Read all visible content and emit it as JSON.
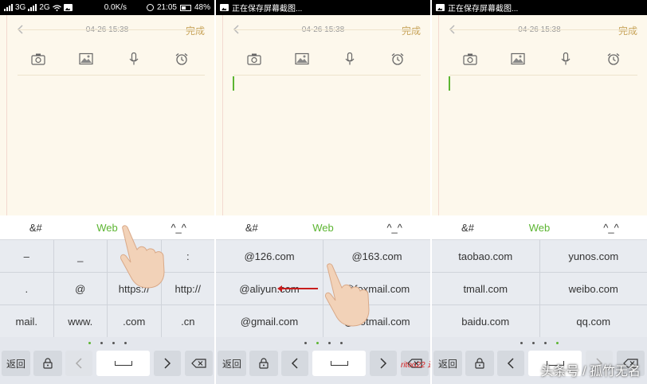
{
  "colors": {
    "accent_green": "#5cb531",
    "done_gold": "#c8a45a",
    "paper": "#fdf8ec",
    "keyboard": "#e4e7ed"
  },
  "panels": [
    {
      "status": {
        "network": "3G",
        "network2": "2G",
        "speed": "0.0K/s",
        "time": "21:05",
        "battery": "48%"
      },
      "header": {
        "date": "04-26 15:38",
        "done": "完成"
      },
      "tabs": [
        "&#",
        "Web",
        "^_^"
      ],
      "keys": [
        "–",
        "_",
        "/",
        ":",
        ".",
        "@",
        "https://",
        "http://",
        "mail.",
        "www.",
        ".com",
        ".cn"
      ],
      "page_dot_active": 0
    },
    {
      "status": {
        "notice": "正在保存屏幕截图..."
      },
      "header": {
        "date": "04-26 15:38",
        "done": "完成"
      },
      "tabs": [
        "&#",
        "Web",
        "^_^"
      ],
      "keys": [
        "@126.com",
        "@163.com",
        "@aliyun.com",
        "@foxmail.com",
        "@gmail.com",
        "@hotmail.com"
      ],
      "page_dot_active": 1
    },
    {
      "status": {
        "notice": "正在保存屏幕截图..."
      },
      "header": {
        "date": "04-26 15:38",
        "done": "完成"
      },
      "tabs": [
        "&#",
        "Web",
        "^_^"
      ],
      "keys": [
        "taobao.com",
        "yunos.com",
        "tmall.com",
        "weibo.com",
        "baidu.com",
        "qq.com"
      ],
      "page_dot_active": 3
    }
  ],
  "bottom_row": {
    "back": "返回"
  },
  "toolbar_icons": [
    "camera-icon",
    "image-icon",
    "microphone-icon",
    "alarm-clock-icon"
  ],
  "watermark": "头条号 / 孤竹无名",
  "watermark_red": "ritoo22 返回"
}
